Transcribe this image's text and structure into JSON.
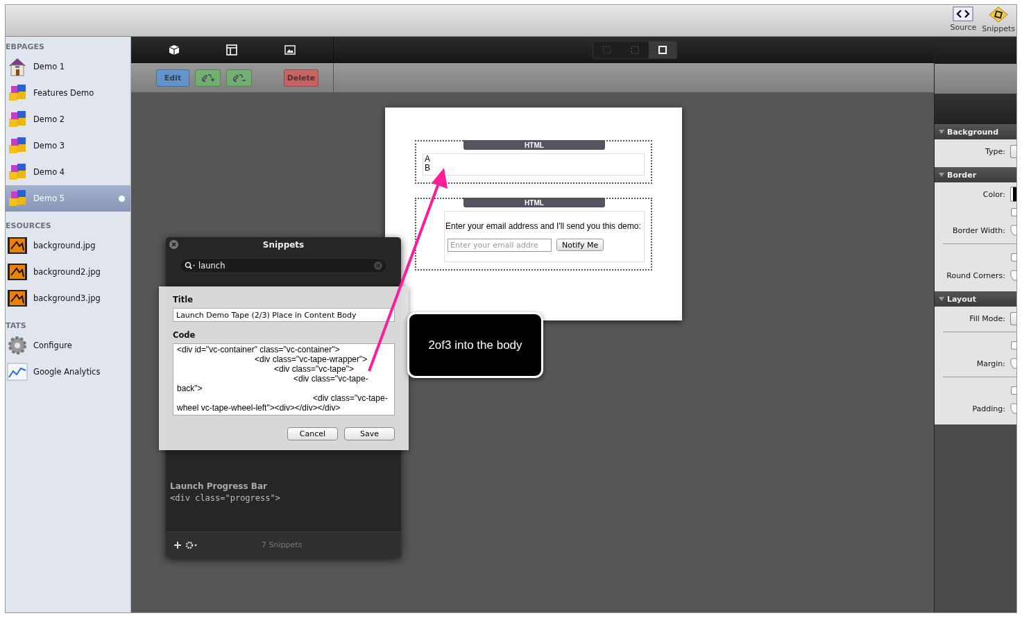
{
  "toolbar": {
    "buttons": [
      {
        "label": "Source",
        "kind": "source"
      },
      {
        "label": "Snippets",
        "kind": "snippets"
      }
    ]
  },
  "sidebar": {
    "sections": [
      {
        "heading": "EBPAGES",
        "items": [
          {
            "label": "Demo 1",
            "kind": "home",
            "selected": false
          },
          {
            "label": "Features Demo",
            "kind": "blocks",
            "selected": false
          },
          {
            "label": "Demo 2",
            "kind": "blocks",
            "selected": false
          },
          {
            "label": "Demo 3",
            "kind": "blocks",
            "selected": false
          },
          {
            "label": "Demo 4",
            "kind": "blocks",
            "selected": false
          },
          {
            "label": "Demo 5",
            "kind": "blocks",
            "selected": true
          }
        ]
      },
      {
        "heading": "ESOURCES",
        "items": [
          {
            "label": "background.jpg",
            "kind": "image",
            "selected": false
          },
          {
            "label": "background2.jpg",
            "kind": "image",
            "selected": false
          },
          {
            "label": "background3.jpg",
            "kind": "image",
            "selected": false
          }
        ]
      },
      {
        "heading": "TATS",
        "items": [
          {
            "label": "Configure",
            "kind": "gear",
            "selected": false
          },
          {
            "label": "Google Analytics",
            "kind": "chart",
            "selected": false
          }
        ]
      }
    ]
  },
  "editor_toolbar": {
    "tools": [
      {
        "kind": "cube"
      },
      {
        "kind": "layout"
      },
      {
        "kind": "picture"
      }
    ],
    "buttons": [
      {
        "label": "Edit",
        "kind": "edit",
        "disabled": true
      },
      {
        "kind": "link-add",
        "disabled": true
      },
      {
        "kind": "link-remove",
        "disabled": true
      },
      {
        "label": "Delete",
        "kind": "delete",
        "disabled": true
      }
    ],
    "view_modes": [
      {
        "kind": "dotted",
        "selected": false
      },
      {
        "kind": "dashed",
        "selected": false
      },
      {
        "kind": "solid",
        "selected": true
      }
    ]
  },
  "page_canvas": {
    "blocks": [
      {
        "header": "HTML",
        "kind": "text",
        "lines": [
          "A",
          "B"
        ]
      },
      {
        "header": "HTML",
        "kind": "form",
        "prompt": "Enter your email address and I'll send you this demo:",
        "placeholder": "Enter your email addre",
        "button": "Notify Me"
      }
    ]
  },
  "snippets_panel": {
    "title": "Snippets",
    "search": {
      "value": "launch"
    },
    "list": [
      {
        "title": "Launch Progress Bar",
        "code": "<div class=\"progress\">"
      }
    ],
    "count": "7 Snippets",
    "editor": {
      "title_label": "Title",
      "title_value": "Launch Demo Tape (2/3) Place in Content Body",
      "code_label": "Code",
      "code_value": "<div id=\"vc-container\" class=\"vc-container\">\n\t\t\t\t<div class=\"vc-tape-wrapper\">\n\t\t\t\t\t<div class=\"vc-tape\">\n\t\t\t\t\t\t<div class=\"vc-tape-back\">\n\t\t\t\t\t\t\t<div class=\"vc-tape-wheel vc-tape-wheel-left\"><div></div></div>",
      "buttons": [
        "Cancel",
        "Save"
      ]
    }
  },
  "inspector": {
    "sections": [
      {
        "title": "Background",
        "rows": [
          {
            "kind": "popup",
            "label": "Type:"
          }
        ]
      },
      {
        "title": "Border",
        "rows": [
          {
            "kind": "color",
            "label": "Color:"
          },
          {
            "kind": "checkbox",
            "checked": false
          },
          {
            "kind": "stepper",
            "label": "Border Width:"
          },
          {
            "kind": "divider"
          },
          {
            "kind": "checkbox",
            "checked": false
          },
          {
            "kind": "stepper",
            "label": "Round Corners:"
          }
        ]
      },
      {
        "title": "Layout",
        "rows": [
          {
            "kind": "popup",
            "label": "Fill Mode:"
          },
          {
            "kind": "divider"
          },
          {
            "kind": "checkbox",
            "checked": false
          },
          {
            "kind": "stepper",
            "label": "Margin:"
          },
          {
            "kind": "divider"
          },
          {
            "kind": "checkbox",
            "checked": false
          },
          {
            "kind": "stepper",
            "label": "Padding:"
          }
        ]
      }
    ]
  },
  "callout": {
    "text": "2of3 into the body"
  }
}
